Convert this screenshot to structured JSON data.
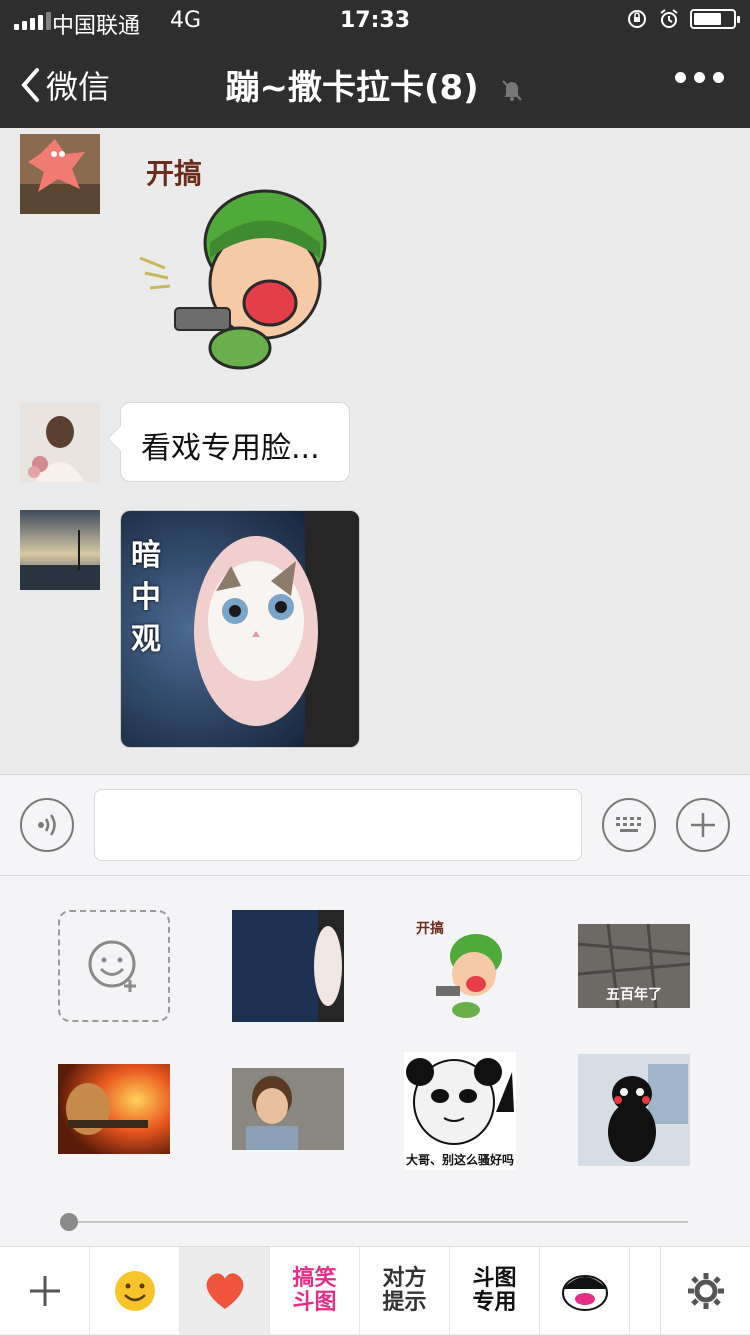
{
  "status_bar": {
    "carrier": "中国联通",
    "network": "4G",
    "time": "17:33",
    "battery_level": 0.7
  },
  "nav": {
    "back_label": "微信",
    "title": "蹦~撒卡拉卡(8)"
  },
  "messages": [
    {
      "type": "sticker",
      "sticker_text": "开搞"
    },
    {
      "type": "text",
      "text": "看戏专用脸..."
    },
    {
      "type": "image",
      "image_text": "暗中观"
    }
  ],
  "input": {
    "placeholder": "",
    "value": ""
  },
  "sticker_panel": {
    "items": [
      {
        "caption": ""
      },
      {
        "caption": "开搞"
      },
      {
        "caption": "五百年了"
      },
      {
        "caption": ""
      },
      {
        "caption": ""
      },
      {
        "caption": "大哥、别这么骚好吗"
      },
      {
        "caption": ""
      }
    ],
    "page_progress": 0.0
  },
  "tabs": [
    {
      "label": ""
    },
    {
      "label": ""
    },
    {
      "label": ""
    },
    {
      "label": "搞笑斗图"
    },
    {
      "label": "对方提示"
    },
    {
      "label": "斗图专用"
    },
    {
      "label": ""
    },
    {
      "label": ""
    }
  ],
  "colors": {
    "nav_bg": "#2e2e2e",
    "chat_bg": "#ebebeb",
    "accent_pink": "#e62d8a",
    "heart": "#f0553c",
    "smiley": "#f7c52b"
  }
}
